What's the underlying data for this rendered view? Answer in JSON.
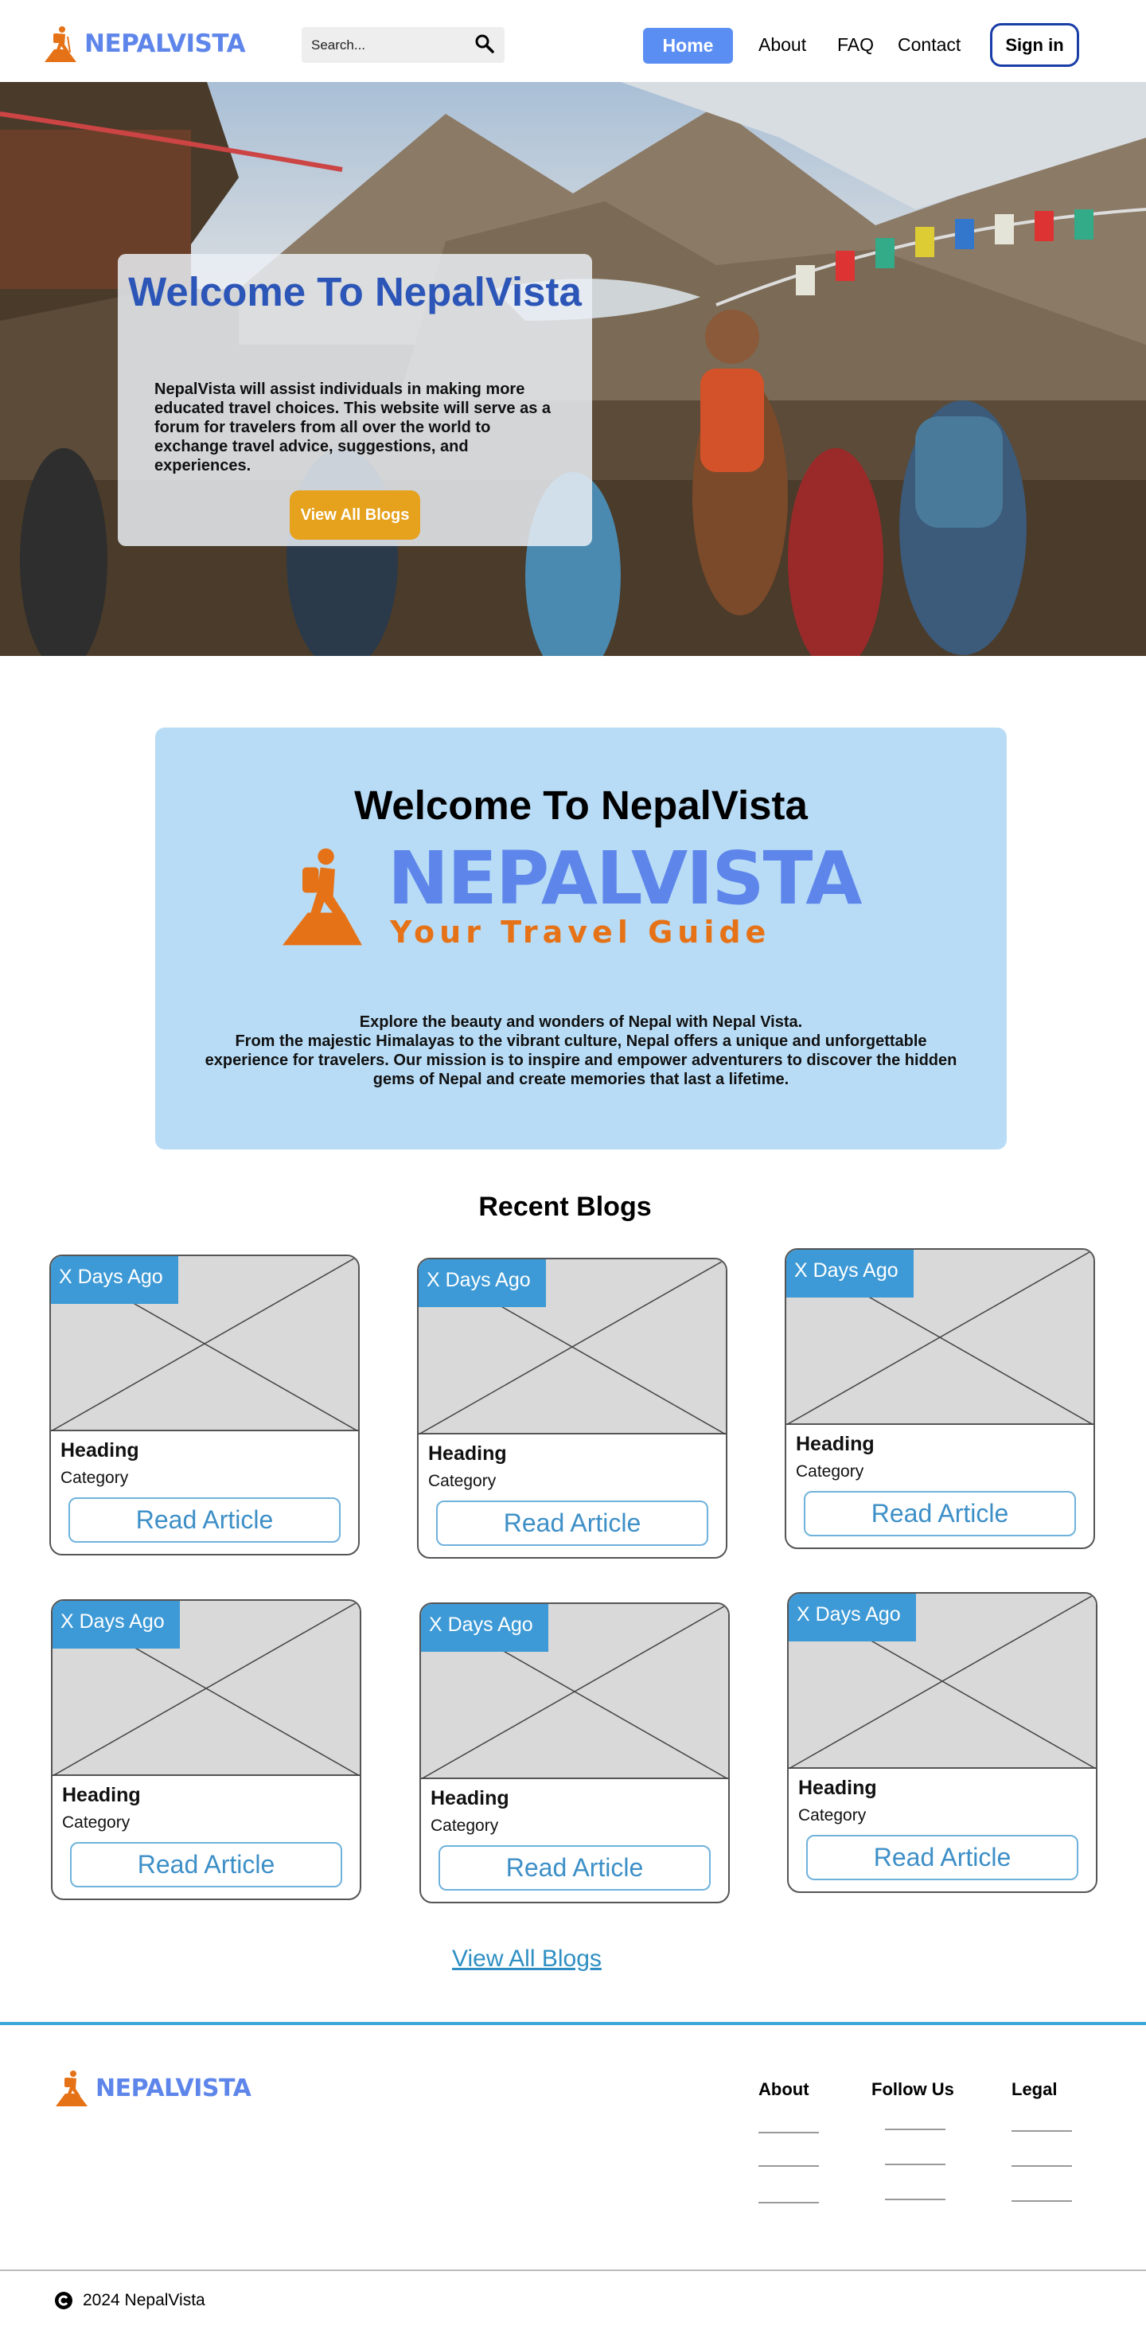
{
  "nav": {
    "brand": "NEPALVISTA",
    "search_placeholder": "Search...",
    "links": {
      "home": "Home",
      "about": "About",
      "faq": "FAQ",
      "contact": "Contact"
    },
    "signin": "Sign in"
  },
  "hero": {
    "title": "Welcome To NepalVista",
    "description": "NepalVista will assist individuals in making more educated travel choices. This website will serve as a forum for travelers from all over the world to exchange travel advice, suggestions, and experiences.",
    "button": "View All Blogs"
  },
  "welcome": {
    "title": "Welcome To NepalVista",
    "logo_word": "NEPALVISTA",
    "logo_tagline": "Your Travel Guide",
    "line1": "Explore the beauty and wonders of Nepal with Nepal Vista.",
    "line2": "From the majestic Himalayas to the vibrant culture, Nepal offers a unique and unforgettable experience for travelers. Our mission is to inspire and empower adventurers to discover the hidden gems of Nepal and create memories that last a lifetime."
  },
  "blogs": {
    "title": "Recent Blogs",
    "cards": [
      {
        "badge": "X Days Ago",
        "heading": "Heading",
        "category": "Category",
        "button": "Read Article"
      },
      {
        "badge": "X Days Ago",
        "heading": "Heading",
        "category": "Category",
        "button": "Read Article"
      },
      {
        "badge": "X Days Ago",
        "heading": "Heading",
        "category": "Category",
        "button": "Read Article"
      },
      {
        "badge": "X Days Ago",
        "heading": "Heading",
        "category": "Category",
        "button": "Read Article"
      },
      {
        "badge": "X Days Ago",
        "heading": "Heading",
        "category": "Category",
        "button": "Read Article"
      },
      {
        "badge": "X Days Ago",
        "heading": "Heading",
        "category": "Category",
        "button": "Read Article"
      }
    ],
    "view_all": "View All Blogs"
  },
  "footer": {
    "brand": "NEPALVISTA",
    "columns": [
      "About",
      "Follow Us",
      "Legal"
    ],
    "copyright": "2024 NepalVista"
  },
  "colors": {
    "brand_blue": "#5e86ea",
    "brand_orange": "#e67217",
    "nav_home": "#5b8ef3",
    "hero_title": "#2c55b8",
    "hero_button": "#e6a11d",
    "welcome_bg": "#b8dcf6",
    "badge": "#3d9ad6",
    "footer_rule": "#3aa7d6"
  },
  "icons": {
    "logo": "hiker-icon",
    "search": "search-icon",
    "copyright": "copyright-icon"
  }
}
